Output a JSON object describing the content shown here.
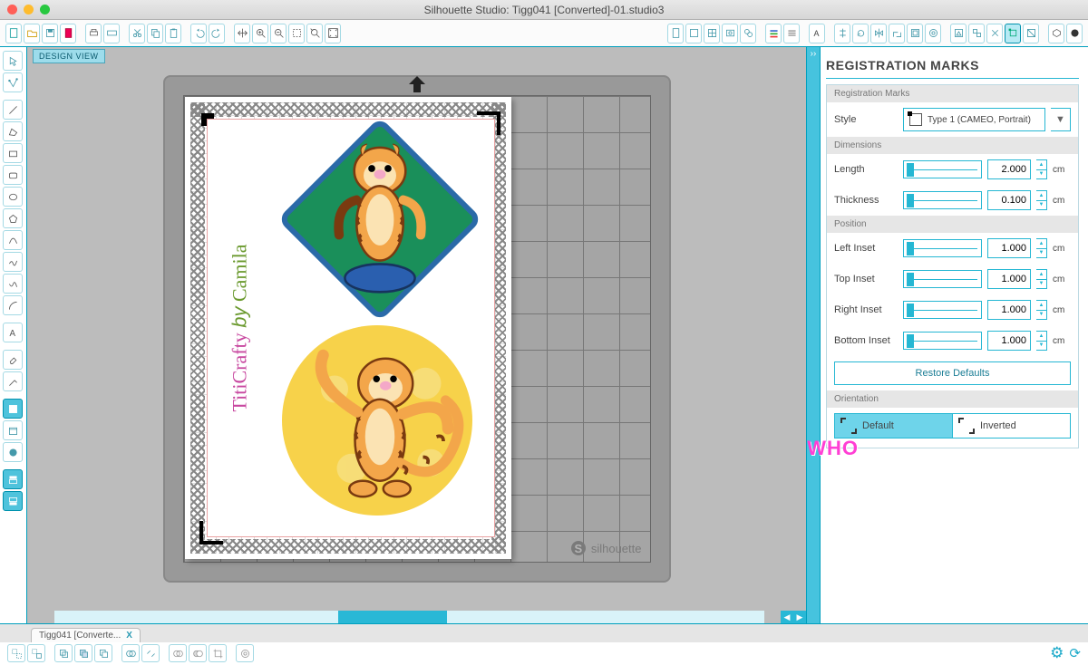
{
  "title": "Silhouette Studio: Tigg041 [Converted]-01.studio3",
  "design_view_label": "DESIGN VIEW",
  "mat_brand": "silhouette",
  "watermark": "WHO",
  "sidebar_art_text_1": "TitiCrafty",
  "sidebar_art_text_2": "Camila",
  "file_tab": "Tigg041 [Converte...",
  "panel": {
    "title": "REGISTRATION MARKS",
    "sections": {
      "reg_marks": "Registration Marks",
      "dimensions": "Dimensions",
      "position": "Position",
      "orientation": "Orientation"
    },
    "labels": {
      "style": "Style",
      "length": "Length",
      "thickness": "Thickness",
      "left_inset": "Left Inset",
      "top_inset": "Top Inset",
      "right_inset": "Right Inset",
      "bottom_inset": "Bottom Inset"
    },
    "style_value": "Type 1 (CAMEO, Portrait)",
    "restore": "Restore Defaults",
    "orientation_default": "Default",
    "orientation_inverted": "Inverted",
    "unit": "cm",
    "values": {
      "length": "2.000",
      "thickness": "0.100",
      "left_inset": "1.000",
      "top_inset": "1.000",
      "right_inset": "1.000",
      "bottom_inset": "1.000"
    }
  }
}
